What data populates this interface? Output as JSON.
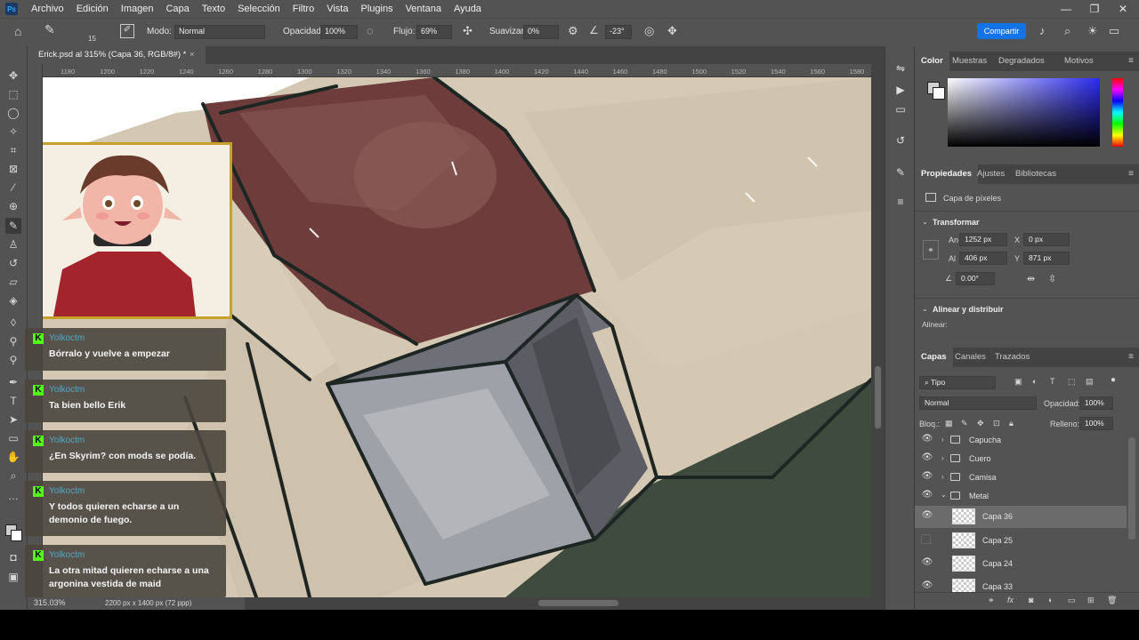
{
  "app": {
    "menu": [
      "Archivo",
      "Edición",
      "Imagen",
      "Capa",
      "Texto",
      "Selección",
      "Filtro",
      "Vista",
      "Plugins",
      "Ventana",
      "Ayuda"
    ],
    "window_controls": {
      "minimize": "—",
      "restore": "❐",
      "close": "✕"
    }
  },
  "options_bar": {
    "brush_size": "15",
    "mode_label": "Modo:",
    "mode_value": "Normal",
    "opacity_label": "Opacidad:",
    "opacity_value": "100%",
    "flow_label": "Flujo:",
    "flow_value": "69%",
    "smoothing_label": "Suavizar:",
    "smoothing_value": "0%",
    "angle_value": "-23°",
    "share_label": "Compartir"
  },
  "document": {
    "tab_title": "Erick.psd al 315% (Capa 36, RGB/8#) *",
    "zoom_status": "315.03%",
    "size_status": "2200 px x 1400 px (72 ppp)",
    "ruler_top": [
      "1180",
      "1200",
      "1220",
      "1240",
      "1260",
      "1280",
      "1300",
      "1320",
      "1340",
      "1360",
      "1380",
      "1400",
      "1420",
      "1440",
      "1460",
      "1480",
      "1500",
      "1520",
      "1540",
      "1560",
      "1580"
    ]
  },
  "chat": [
    {
      "user": "Yolkoctm",
      "message": "Bórralo y vuelve a empezar"
    },
    {
      "user": "Yolkoctm",
      "message": "Ta bien bello Erik"
    },
    {
      "user": "Yolkoctm",
      "message": "¿En Skyrim? con mods se podía."
    },
    {
      "user": "Yolkoctm",
      "message": "Y todos quieren echarse a un demonio de fuego."
    },
    {
      "user": "Yolkoctm",
      "message": "La otra mitad quieren echarse a una argonina vestida de maid"
    }
  ],
  "color_panel": {
    "tabs": [
      "Color",
      "Muestras",
      "Degradados",
      "Motivos"
    ],
    "active_tab": "Color"
  },
  "properties_panel": {
    "tabs": [
      "Propiedades",
      "Ajustes",
      "Bibliotecas"
    ],
    "layer_kind": "Capa de píxeles",
    "transform_title": "Transformar",
    "width_label": "An",
    "width_value": "1252 px",
    "height_label": "Al",
    "height_value": "406 px",
    "x_label": "X",
    "x_value": "0 px",
    "y_label": "Y",
    "y_value": "871 px",
    "angle_value": "0.00°",
    "align_title": "Alinear y distribuir",
    "align_label": "Alinear:"
  },
  "layers_panel": {
    "tabs": [
      "Capas",
      "Canales",
      "Trazados"
    ],
    "filter_value": "Tipo",
    "blend_mode": "Normal",
    "opacity_label": "Opacidad:",
    "opacity_value": "100%",
    "lock_label": "Bloq.:",
    "fill_label": "Relleno:",
    "fill_value": "100%",
    "layers": [
      {
        "name": "Capucha",
        "type": "group",
        "visible": true
      },
      {
        "name": "Cuero",
        "type": "group",
        "visible": true
      },
      {
        "name": "Camisa",
        "type": "group",
        "visible": true
      },
      {
        "name": "Metal",
        "type": "group",
        "visible": true,
        "expanded": true
      },
      {
        "name": "Capa 36",
        "type": "pixel",
        "visible": true,
        "selected": true
      },
      {
        "name": "Capa 25",
        "type": "pixel",
        "visible": false
      },
      {
        "name": "Capa 24",
        "type": "pixel",
        "visible": true
      },
      {
        "name": "Capa 33",
        "type": "pixel",
        "visible": true
      }
    ]
  },
  "colors": {
    "accent": "#1473e6",
    "kick_green": "#53fc18",
    "frame_gold": "#c5a12a",
    "hood_red": "#6b3a3a",
    "metal_gray": "#8e8f95",
    "cloak_green": "#3e4a3d",
    "beige": "#cfc2ac"
  }
}
